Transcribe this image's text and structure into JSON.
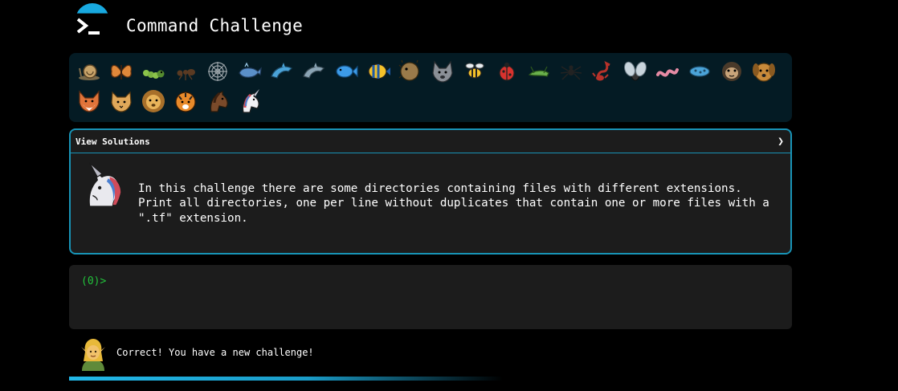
{
  "app": {
    "title": "Command Challenge"
  },
  "animals": [
    {
      "name": "snail"
    },
    {
      "name": "butterfly"
    },
    {
      "name": "caterpillar"
    },
    {
      "name": "ant"
    },
    {
      "name": "spider-web"
    },
    {
      "name": "whale"
    },
    {
      "name": "dolphin"
    },
    {
      "name": "dolphin-gray"
    },
    {
      "name": "fish"
    },
    {
      "name": "tropical-fish"
    },
    {
      "name": "blowfish"
    },
    {
      "name": "wolf"
    },
    {
      "name": "bee"
    },
    {
      "name": "lady-beetle"
    },
    {
      "name": "cricket"
    },
    {
      "name": "spider"
    },
    {
      "name": "scorpion"
    },
    {
      "name": "fly"
    },
    {
      "name": "worm"
    },
    {
      "name": "microbe"
    },
    {
      "name": "monkey"
    },
    {
      "name": "dog"
    },
    {
      "name": "fox"
    },
    {
      "name": "cat"
    },
    {
      "name": "lion"
    },
    {
      "name": "tiger"
    },
    {
      "name": "horse"
    },
    {
      "name": "unicorn"
    }
  ],
  "panel": {
    "header_label": "View Solutions",
    "chevron": "❯",
    "avatar_icon": "unicorn-icon",
    "description": "In this challenge there are some directories containing files with different extensions.\nPrint all directories, one per line without duplicates that contain one or more files with a\n\".tf\" extension."
  },
  "terminal": {
    "prompt": "(0)>"
  },
  "status": {
    "avatar_icon": "elf-icon",
    "message": "Correct! You have a new challenge!"
  },
  "progress": {
    "fraction": 0.6
  },
  "colors": {
    "background": "#000000",
    "panel": "#1c1c1c",
    "animal_bar": "#041b24",
    "accent": "#1893b6",
    "prompt": "#22c23b"
  }
}
